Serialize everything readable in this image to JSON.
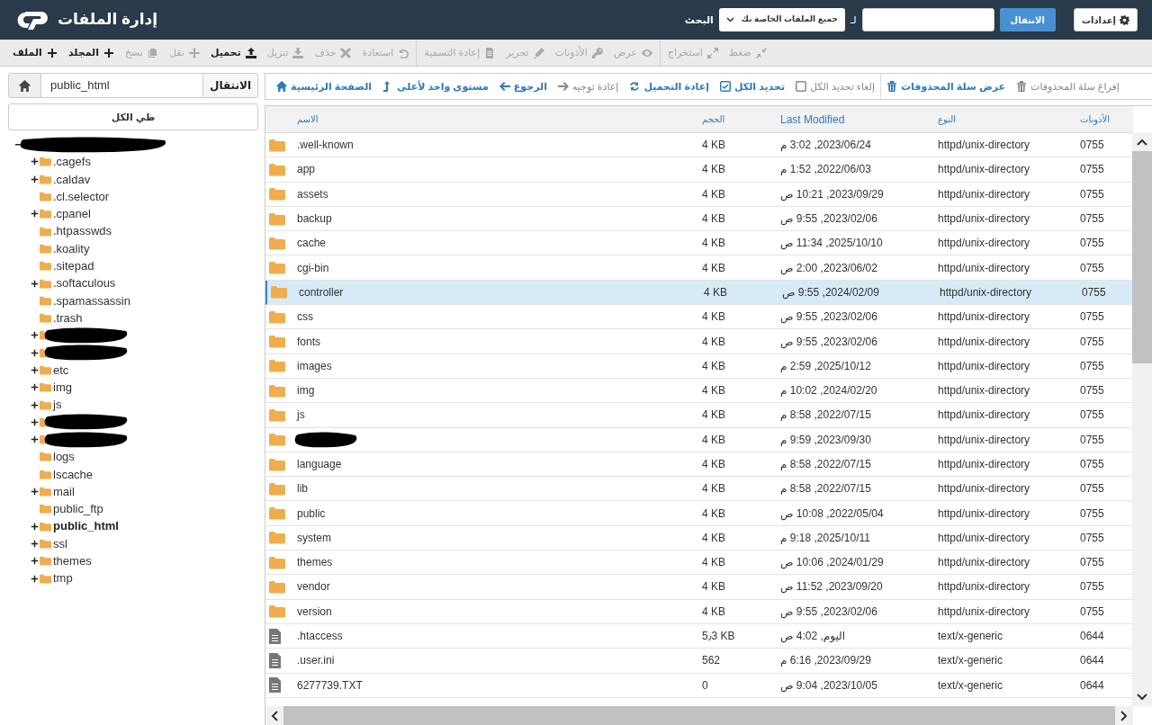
{
  "header": {
    "title": "إدارة الملفات",
    "search_label": "البحث",
    "search_scope": "جميع الملفات الخاصة بك",
    "for_label": "لـ",
    "go_button": "الانتقال",
    "settings_button": "إعدادات"
  },
  "toolbar": [
    [
      {
        "label": "ضغط",
        "disabled": true
      },
      {
        "label": "استخراج",
        "disabled": true
      }
    ],
    [
      {
        "label": "عرض",
        "disabled": true
      },
      {
        "label": "الأذونات",
        "disabled": true
      },
      {
        "label": "تحرير",
        "disabled": true
      },
      {
        "label": "إعادة التسمية",
        "disabled": true
      }
    ],
    [
      {
        "label": "استعادة",
        "disabled": true
      },
      {
        "label": "حذف",
        "disabled": true
      },
      {
        "label": "تنزيل",
        "disabled": true
      },
      {
        "label": "تحميل",
        "disabled": false
      },
      {
        "label": "نقل",
        "disabled": true
      },
      {
        "label": "نسخ",
        "disabled": true
      },
      {
        "label": "المجلد",
        "disabled": false
      },
      {
        "label": "الملف",
        "disabled": false
      }
    ]
  ],
  "sidebar": {
    "path_value": "public_html",
    "go_button": "الانتقال",
    "collapse_button": "طي الكل",
    "tree": {
      "kind": "redacted",
      "expanded": true,
      "children": [
        {
          "kind": "folder",
          "label": ".cagefs",
          "expandable": true,
          "current": false
        },
        {
          "kind": "folder",
          "label": ".caldav",
          "expandable": true,
          "current": false
        },
        {
          "kind": "folder",
          "label": ".cl.selector",
          "expandable": false,
          "current": false
        },
        {
          "kind": "folder",
          "label": ".cpanel",
          "expandable": true,
          "current": false
        },
        {
          "kind": "folder",
          "label": ".htpasswds",
          "expandable": false,
          "current": false
        },
        {
          "kind": "folder",
          "label": ".koality",
          "expandable": false,
          "current": false
        },
        {
          "kind": "folder",
          "label": ".sitepad",
          "expandable": false,
          "current": false
        },
        {
          "kind": "folder",
          "label": ".softaculous",
          "expandable": true,
          "current": false
        },
        {
          "kind": "folder",
          "label": ".spamassassin",
          "expandable": false,
          "current": false
        },
        {
          "kind": "folder",
          "label": ".trash",
          "expandable": false,
          "current": false
        },
        {
          "kind": "redacted",
          "expandable": true
        },
        {
          "kind": "redacted",
          "expandable": true
        },
        {
          "kind": "folder",
          "label": "etc",
          "expandable": true,
          "current": false
        },
        {
          "kind": "folder",
          "label": "img",
          "expandable": true,
          "current": false
        },
        {
          "kind": "folder",
          "label": "js",
          "expandable": true,
          "current": false
        },
        {
          "kind": "redacted",
          "expandable": true
        },
        {
          "kind": "redacted",
          "expandable": true
        },
        {
          "kind": "folder",
          "label": "logs",
          "expandable": false,
          "current": false
        },
        {
          "kind": "folder",
          "label": "lscache",
          "expandable": false,
          "current": false
        },
        {
          "kind": "folder",
          "label": "mail",
          "expandable": true,
          "current": false
        },
        {
          "kind": "folder",
          "label": "public_ftp",
          "expandable": false,
          "current": false
        },
        {
          "kind": "folder",
          "label": "public_html",
          "expandable": true,
          "current": true
        },
        {
          "kind": "folder",
          "label": "ssl",
          "expandable": true,
          "current": false
        },
        {
          "kind": "folder",
          "label": "themes",
          "expandable": true,
          "current": false
        },
        {
          "kind": "folder",
          "label": "tmp",
          "expandable": true,
          "current": false
        }
      ]
    }
  },
  "nav_toolbar": [
    [
      {
        "label": "إفراغ سلة المحذوفات",
        "disabled": true
      },
      {
        "label": "عرض سلة المحذوفات",
        "disabled": false
      }
    ],
    [
      {
        "label": "إلغاء تحديد الكل",
        "disabled": true
      },
      {
        "label": "تحديد الكل",
        "disabled": false
      },
      {
        "label": "إعادة التحميل",
        "disabled": false
      },
      {
        "label": "إعادة توجيه",
        "disabled": true
      },
      {
        "label": "الرجوع",
        "disabled": false
      },
      {
        "label": "مستوى واحد لأعلى",
        "disabled": false
      },
      {
        "label": "الصفحة الرئيسية",
        "disabled": false
      }
    ]
  ],
  "table": {
    "columns": [
      "الأذونات",
      "النوع",
      "Last Modified",
      "الحجم",
      "الاسم"
    ],
    "rows": [
      {
        "kind": "folder",
        "name": ".well-known",
        "size": "4 KB",
        "modified": "2023/06/24, 3:02 م",
        "type": "httpd/unix-directory",
        "perms": "0755",
        "selected": false
      },
      {
        "kind": "folder",
        "name": "app",
        "size": "4 KB",
        "modified": "2022/06/03, 1:52 م",
        "type": "httpd/unix-directory",
        "perms": "0755",
        "selected": false
      },
      {
        "kind": "folder",
        "name": "assets",
        "size": "4 KB",
        "modified": "2023/09/29, 10:21 ص",
        "type": "httpd/unix-directory",
        "perms": "0755",
        "selected": false
      },
      {
        "kind": "folder",
        "name": "backup",
        "size": "4 KB",
        "modified": "2023/02/06, 9:55 ص",
        "type": "httpd/unix-directory",
        "perms": "0755",
        "selected": false
      },
      {
        "kind": "folder",
        "name": "cache",
        "size": "4 KB",
        "modified": "2025/10/10, 11:34 ص",
        "type": "httpd/unix-directory",
        "perms": "0755",
        "selected": false
      },
      {
        "kind": "folder",
        "name": "cgi-bin",
        "size": "4 KB",
        "modified": "2023/06/02, 2:00 ص",
        "type": "httpd/unix-directory",
        "perms": "0755",
        "selected": false
      },
      {
        "kind": "folder",
        "name": "controller",
        "size": "4 KB",
        "modified": "2024/02/09, 9:55 ص",
        "type": "httpd/unix-directory",
        "perms": "0755",
        "selected": true
      },
      {
        "kind": "folder",
        "name": "css",
        "size": "4 KB",
        "modified": "2023/02/06, 9:55 ص",
        "type": "httpd/unix-directory",
        "perms": "0755",
        "selected": false
      },
      {
        "kind": "folder",
        "name": "fonts",
        "size": "4 KB",
        "modified": "2023/02/06, 9:55 ص",
        "type": "httpd/unix-directory",
        "perms": "0755",
        "selected": false
      },
      {
        "kind": "folder",
        "name": "images",
        "size": "4 KB",
        "modified": "2025/10/12, 2:59 م",
        "type": "httpd/unix-directory",
        "perms": "0755",
        "selected": false
      },
      {
        "kind": "folder",
        "name": "img",
        "size": "4 KB",
        "modified": "2024/02/20, 10:02 م",
        "type": "httpd/unix-directory",
        "perms": "0755",
        "selected": false
      },
      {
        "kind": "folder",
        "name": "js",
        "size": "4 KB",
        "modified": "2022/07/15, 8:58 م",
        "type": "httpd/unix-directory",
        "perms": "0755",
        "selected": false
      },
      {
        "kind": "redacted-folder",
        "size": "4 KB",
        "modified": "2023/09/30, 9:59 م",
        "type": "httpd/unix-directory",
        "perms": "0755",
        "selected": false
      },
      {
        "kind": "folder",
        "name": "language",
        "size": "4 KB",
        "modified": "2022/07/15, 8:58 م",
        "type": "httpd/unix-directory",
        "perms": "0755",
        "selected": false
      },
      {
        "kind": "folder",
        "name": "lib",
        "size": "4 KB",
        "modified": "2022/07/15, 8:58 م",
        "type": "httpd/unix-directory",
        "perms": "0755",
        "selected": false
      },
      {
        "kind": "folder",
        "name": "public",
        "size": "4 KB",
        "modified": "2022/05/04, 10:08 ص",
        "type": "httpd/unix-directory",
        "perms": "0755",
        "selected": false
      },
      {
        "kind": "folder",
        "name": "system",
        "size": "4 KB",
        "modified": "2025/10/11, 9:18 م",
        "type": "httpd/unix-directory",
        "perms": "0755",
        "selected": false
      },
      {
        "kind": "folder",
        "name": "themes",
        "size": "4 KB",
        "modified": "2024/01/29, 10:06 ص",
        "type": "httpd/unix-directory",
        "perms": "0755",
        "selected": false
      },
      {
        "kind": "folder",
        "name": "vendor",
        "size": "4 KB",
        "modified": "2023/09/20, 11:52 ص",
        "type": "httpd/unix-directory",
        "perms": "0755",
        "selected": false
      },
      {
        "kind": "folder",
        "name": "version",
        "size": "4 KB",
        "modified": "2023/02/06, 9:55 ص",
        "type": "httpd/unix-directory",
        "perms": "0755",
        "selected": false
      },
      {
        "kind": "file",
        "name": ".htaccess",
        "size": "5٫3 KB",
        "modified": "اليوم, 4:02 ص",
        "type": "text/x-generic",
        "perms": "0644",
        "selected": false
      },
      {
        "kind": "file",
        "name": ".user.ini",
        "size": "562",
        "modified": "2023/09/29, 6:16 م",
        "type": "text/x-generic",
        "perms": "0644",
        "selected": false
      },
      {
        "kind": "file",
        "name": "6277739.TXT",
        "size": "0",
        "modified": "2023/10/05, 9:04 ص",
        "type": "text/x-generic",
        "perms": "0644",
        "selected": false
      }
    ]
  }
}
